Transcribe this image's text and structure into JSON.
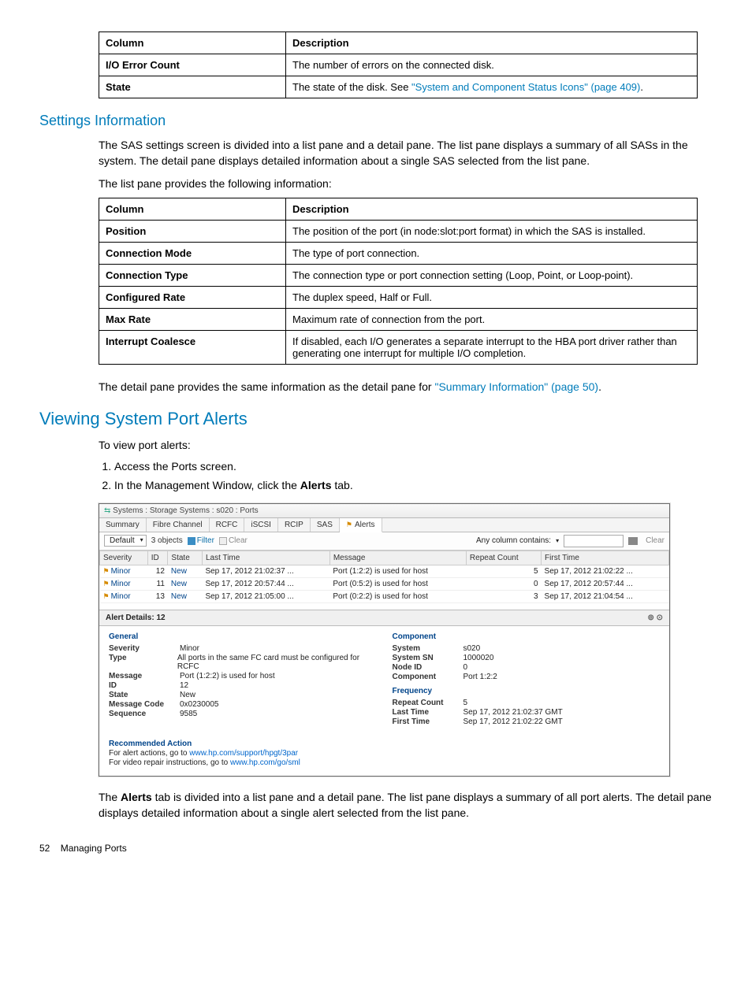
{
  "table1": {
    "headers": [
      "Column",
      "Description"
    ],
    "rows": [
      [
        "I/O Error Count",
        "The number of errors on the connected disk."
      ],
      [
        "State",
        "The state of the disk. See "
      ]
    ],
    "state_link": "\"System and Component Status Icons\" (page 409)",
    "state_suffix": "."
  },
  "section_settings_title": "Settings Information",
  "settings_p1": "The SAS settings screen is divided into a list pane and a detail pane. The list pane displays a summary of all SASs in the system. The detail pane displays detailed information about a single SAS selected from the list pane.",
  "settings_p2": "The list pane provides the following information:",
  "table2": {
    "headers": [
      "Column",
      "Description"
    ],
    "rows": [
      [
        "Position",
        "The position of the port (in node:slot:port format) in which the SAS is installed."
      ],
      [
        "Connection Mode",
        "The type of port connection."
      ],
      [
        "Connection Type",
        "The connection type or port connection setting (Loop, Point, or Loop-point)."
      ],
      [
        "Configured Rate",
        "The duplex speed, Half or Full."
      ],
      [
        "Max Rate",
        "Maximum rate of connection from the port."
      ],
      [
        "Interrupt Coalesce",
        "If disabled, each I/O generates a separate interrupt to the HBA port driver rather than generating one interrupt for multiple I/O completion."
      ]
    ]
  },
  "settings_p3_prefix": "The detail pane provides the same information as the detail pane for ",
  "settings_p3_link": "\"Summary Information\" (page 50)",
  "settings_p3_suffix": ".",
  "section_alerts_title": "Viewing System Port Alerts",
  "alerts_intro": "To view port alerts:",
  "alerts_steps": [
    "Access the Ports screen.",
    "In the Management Window, click the "
  ],
  "alerts_step2_bold": "Alerts",
  "alerts_step2_suffix": " tab.",
  "screenshot": {
    "breadcrumb": "Systems : Storage Systems : s020 : Ports",
    "tabs": [
      "Summary",
      "Fibre Channel",
      "RCFC",
      "iSCSI",
      "RCIP",
      "SAS",
      "Alerts"
    ],
    "toolbar": {
      "dropdown": "Default",
      "count": "3 objects",
      "filter": "Filter",
      "clear": "Clear",
      "contains_label": "Any column contains:",
      "clear2": "Clear"
    },
    "grid": {
      "headers": [
        "Severity",
        "ID",
        "State",
        "Last Time",
        "Message",
        "Repeat Count",
        "First Time"
      ],
      "rows": [
        {
          "sev": "Minor",
          "id": "12",
          "state": "New",
          "last": "Sep 17, 2012 21:02:37 ...",
          "msg": "Port (1:2:2) is used for host",
          "rc": "5",
          "first": "Sep 17, 2012 21:02:22 ..."
        },
        {
          "sev": "Minor",
          "id": "11",
          "state": "New",
          "last": "Sep 17, 2012 20:57:44 ...",
          "msg": "Port (0:5:2) is used for host",
          "rc": "0",
          "first": "Sep 17, 2012 20:57:44 ..."
        },
        {
          "sev": "Minor",
          "id": "13",
          "state": "New",
          "last": "Sep 17, 2012 21:05:00 ...",
          "msg": "Port (0:2:2) is used for host",
          "rc": "3",
          "first": "Sep 17, 2012 21:04:54 ..."
        }
      ]
    },
    "details": {
      "header": "Alert Details: 12",
      "general": {
        "title": "General",
        "items": [
          {
            "k": "Severity",
            "v": "Minor"
          },
          {
            "k": "Type",
            "v": "All ports in the same FC card must be configured for RCFC"
          },
          {
            "k": "Message",
            "v": "Port (1:2:2) is used for host"
          },
          {
            "k": "ID",
            "v": "12"
          },
          {
            "k": "State",
            "v": "New"
          },
          {
            "k": "Message Code",
            "v": "0x0230005"
          },
          {
            "k": "Sequence",
            "v": "9585"
          }
        ]
      },
      "component": {
        "title": "Component",
        "items": [
          {
            "k": "System",
            "v": "s020"
          },
          {
            "k": "System SN",
            "v": "1000020"
          },
          {
            "k": "Node ID",
            "v": "0"
          },
          {
            "k": "Component",
            "v": "Port 1:2:2"
          }
        ]
      },
      "frequency": {
        "title": "Frequency",
        "items": [
          {
            "k": "Repeat Count",
            "v": "5"
          },
          {
            "k": "Last Time",
            "v": "Sep 17, 2012 21:02:37 GMT"
          },
          {
            "k": "First Time",
            "v": "Sep 17, 2012 21:02:22 GMT"
          }
        ]
      },
      "recommended": {
        "title": "Recommended Action",
        "lines": [
          {
            "prefix": "For alert actions, go to ",
            "link": "www.hp.com/support/hpgt/3par"
          },
          {
            "prefix": "For video repair instructions, go to ",
            "link": "www.hp.com/go/sml"
          }
        ]
      }
    }
  },
  "after_shot_p_prefix": "The ",
  "after_shot_bold": "Alerts",
  "after_shot_p_suffix": " tab is divided into a list pane and a detail pane. The list pane displays a summary of all port alerts. The detail pane displays detailed information about a single alert selected from the list pane.",
  "footer_page": "52",
  "footer_text": "Managing Ports"
}
